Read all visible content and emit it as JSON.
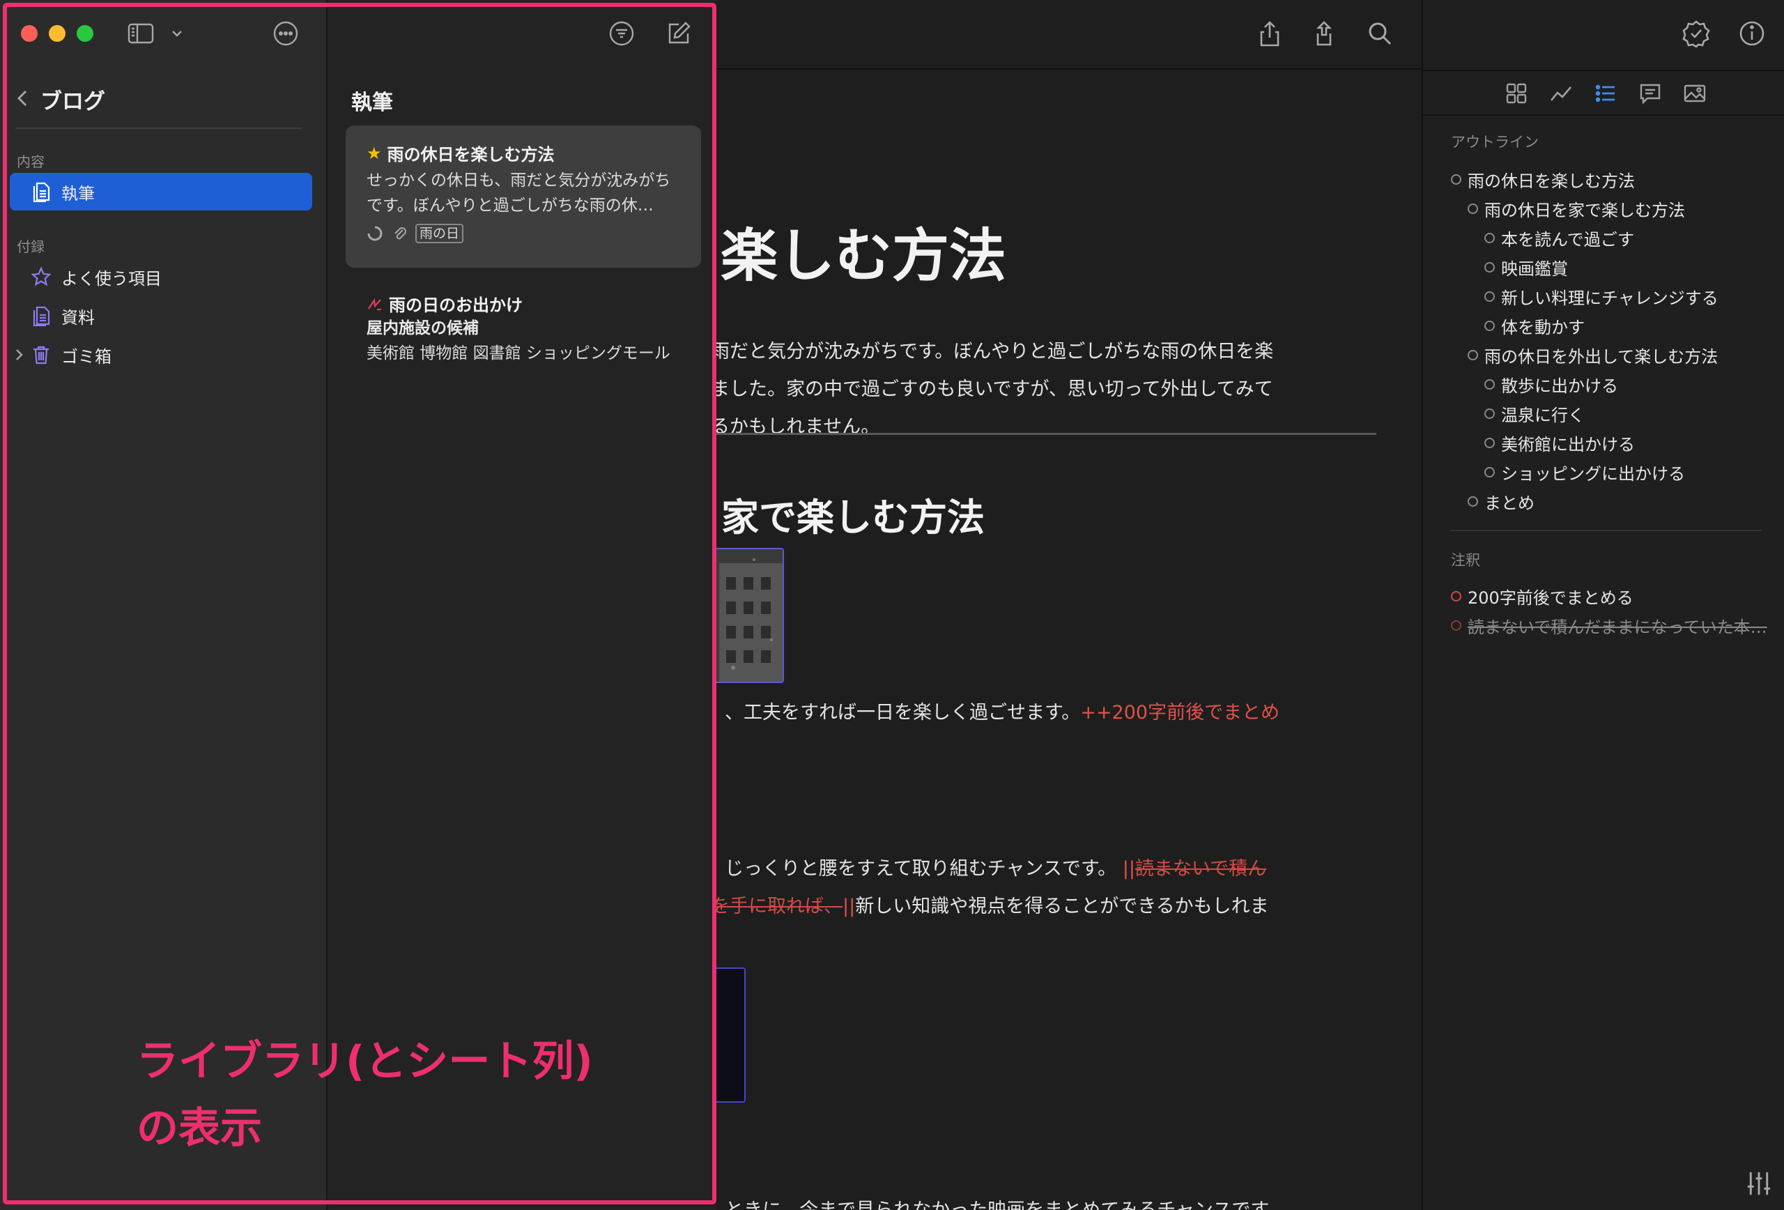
{
  "editor": {
    "toolbar": {
      "share_icon": "share-icon",
      "export_icon": "export-icon",
      "search_icon": "search-icon"
    },
    "title": "日を楽しむ方法",
    "paragraph1_lines": [
      "雨だと気分が沈みがちです。ぼんやりと過ごしがちな雨の休日を楽",
      "ました。家の中で過ごすのも良いですが、思い切って外出してみて",
      "るかもしれません。"
    ],
    "heading2": "家で楽しむ方法",
    "paragraph2_text": "、工夫をすれば一日を楽しく過ごせます。",
    "paragraph2_insert": "++200字前後でまとめ",
    "paragraph3_text": "じっくりと腰をすえて取り組むチャンスです。",
    "paragraph3_delete_mark": "||",
    "paragraph3_delete": "読まないで積ん",
    "paragraph4_delete": "を手に取れば、",
    "paragraph4_delete_mark": "||",
    "paragraph4_text": "新しい知識や視点を得ることができるかもしれま",
    "paragraph5_text": "ときに、今まで見られなかった映画をまとめてみるチャンスです。"
  },
  "inspector": {
    "tabs": [
      "overview-icon",
      "progress-icon",
      "outline-icon",
      "comments-icon",
      "images-icon"
    ],
    "active_tab": "outline-icon",
    "outline_label": "アウトライン",
    "outline": [
      {
        "text": "雨の休日を楽しむ方法",
        "level": 0
      },
      {
        "text": "雨の休日を家で楽しむ方法",
        "level": 1
      },
      {
        "text": "本を読んで過ごす",
        "level": 2
      },
      {
        "text": "映画鑑賞",
        "level": 2
      },
      {
        "text": "新しい料理にチャレンジする",
        "level": 2
      },
      {
        "text": "体を動かす",
        "level": 2
      },
      {
        "text": "雨の休日を外出して楽しむ方法",
        "level": 1
      },
      {
        "text": "散歩に出かける",
        "level": 2
      },
      {
        "text": "温泉に行く",
        "level": 2
      },
      {
        "text": "美術館に出かける",
        "level": 2
      },
      {
        "text": "ショッピングに出かける",
        "level": 2
      },
      {
        "text": "まとめ",
        "level": 1
      }
    ],
    "annotations_label": "注釈",
    "annotations": [
      {
        "text": "200字前後でまとめる",
        "struck": false
      },
      {
        "text": "読まないで積んだままになっていた本…",
        "struck": true
      }
    ]
  },
  "library": {
    "title": "ブログ",
    "contents_label": "内容",
    "selected_group": "執筆",
    "attachments_label": "付録",
    "items": [
      {
        "label": "よく使う項目",
        "icon": "star-icon"
      },
      {
        "label": "資料",
        "icon": "document-icon"
      },
      {
        "label": "ゴミ箱",
        "icon": "trash-icon"
      }
    ]
  },
  "sheets": {
    "title": "執筆",
    "cards": [
      {
        "title": "雨の休日を楽しむ方法",
        "excerpt": "せっかくの休日も、雨だと気分が沈みがちです。ぼんやりと過ごしがちな雨の休…",
        "tag": "雨の日",
        "selected": true
      },
      {
        "title": "雨の日のお出かけ",
        "subtitle": "屋内施設の候補",
        "excerpt": "美術館 博物館 図書館 ショッピングモール",
        "selected": false
      }
    ]
  },
  "caption": {
    "line1": "ライブラリ(とシート列)",
    "line2": "の表示"
  },
  "colors": {
    "accent": "#1f5fd6",
    "highlight": "#ee2f6d",
    "annotation": "#e0524a"
  }
}
